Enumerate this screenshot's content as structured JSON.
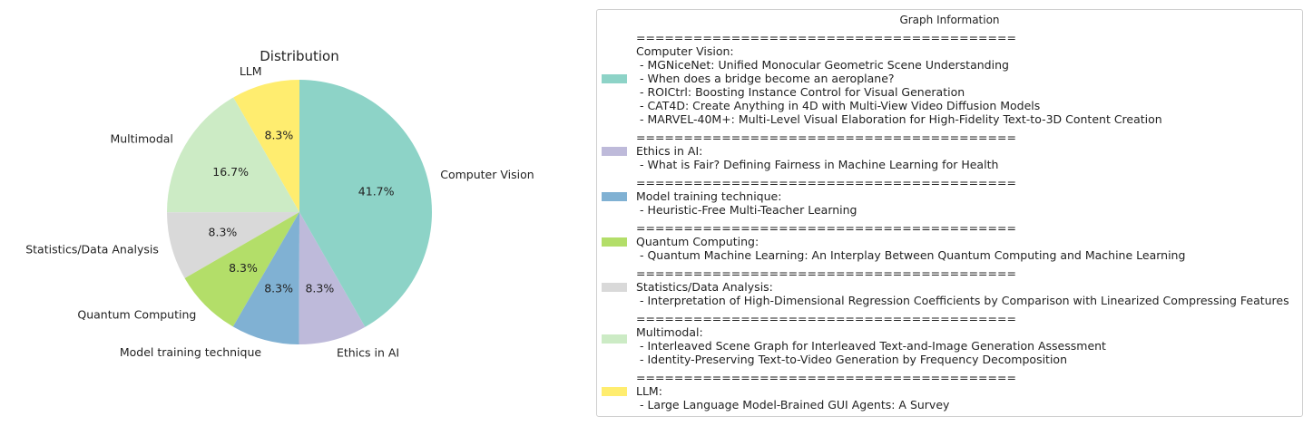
{
  "chart_data": {
    "type": "pie",
    "title": "Distribution",
    "slices": [
      {
        "label": "LLM",
        "value": 8.3,
        "pct_label": "8.3%",
        "color": "#ffed6f"
      },
      {
        "label": "Multimodal",
        "value": 16.7,
        "pct_label": "16.7%",
        "color": "#ccebc5"
      },
      {
        "label": "Statistics/Data Analysis",
        "value": 8.3,
        "pct_label": "8.3%",
        "color": "#d9d9d9"
      },
      {
        "label": "Quantum Computing",
        "value": 8.3,
        "pct_label": "8.3%",
        "color": "#b3de69"
      },
      {
        "label": "Model training technique",
        "value": 8.3,
        "pct_label": "8.3%",
        "color": "#80b1d3"
      },
      {
        "label": "Ethics in AI",
        "value": 8.3,
        "pct_label": "8.3%",
        "color": "#bebada"
      },
      {
        "label": "Computer Vision",
        "value": 41.7,
        "pct_label": "41.7%",
        "color": "#8dd3c7"
      }
    ]
  },
  "legend": {
    "title": "Graph Information",
    "separator": "========================================",
    "groups": [
      {
        "name": "Computer Vision:",
        "color": "#8dd3c7",
        "items": [
          " - MGNiceNet: Unified Monocular Geometric Scene Understanding",
          " - When does a bridge become an aeroplane?",
          " - ROICtrl: Boosting Instance Control for Visual Generation",
          " - CAT4D: Create Anything in 4D with Multi-View Video Diffusion Models",
          " - MARVEL-40M+: Multi-Level Visual Elaboration for High-Fidelity Text-to-3D Content Creation"
        ]
      },
      {
        "name": "Ethics in AI:",
        "color": "#bebada",
        "items": [
          " - What is Fair? Defining Fairness in Machine Learning for Health"
        ]
      },
      {
        "name": "Model training technique:",
        "color": "#80b1d3",
        "items": [
          " - Heuristic-Free Multi-Teacher Learning"
        ]
      },
      {
        "name": "Quantum Computing:",
        "color": "#b3de69",
        "items": [
          " - Quantum Machine Learning: An Interplay Between Quantum Computing and Machine Learning"
        ]
      },
      {
        "name": "Statistics/Data Analysis:",
        "color": "#d9d9d9",
        "items": [
          " - Interpretation of High-Dimensional Regression Coefficients by Comparison with Linearized Compressing Features"
        ]
      },
      {
        "name": "Multimodal:",
        "color": "#ccebc5",
        "items": [
          " - Interleaved Scene Graph for Interleaved Text-and-Image Generation Assessment",
          " - Identity-Preserving Text-to-Video Generation by Frequency Decomposition"
        ]
      },
      {
        "name": "LLM:",
        "color": "#ffed6f",
        "items": [
          " - Large Language Model-Brained GUI Agents: A Survey"
        ]
      }
    ]
  }
}
